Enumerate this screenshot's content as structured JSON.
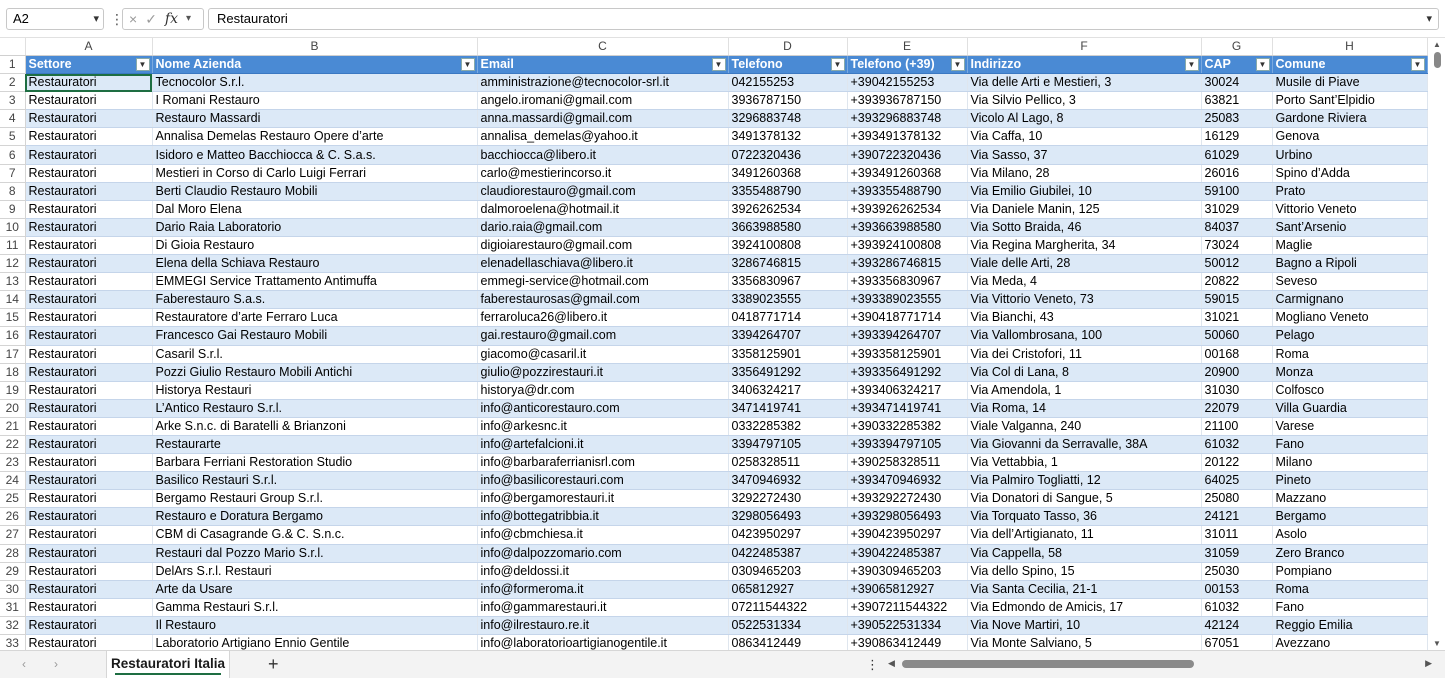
{
  "formula_bar": {
    "name_box": "A2",
    "formula": "Restauratori",
    "separator": "⋮",
    "cancel_icon": "×",
    "enter_icon": "✓",
    "fx_label": "fx"
  },
  "columns": [
    "A",
    "B",
    "C",
    "D",
    "E",
    "F",
    "G",
    "H"
  ],
  "headers": [
    "Settore",
    "Nome Azienda",
    "Email",
    "Telefono",
    "Telefono (+39)",
    "Indirizzo",
    "CAP",
    "Comune"
  ],
  "rows": [
    [
      "Restauratori",
      "Tecnocolor S.r.l.",
      "amministrazione@tecnocolor-srl.it",
      "042155253",
      "+39042155253",
      "Via delle Arti e Mestieri, 3",
      "30024",
      "Musile di Piave"
    ],
    [
      "Restauratori",
      "I Romani Restauro",
      "angelo.iromani@gmail.com",
      "3936787150",
      "+393936787150",
      "Via Silvio Pellico, 3",
      "63821",
      "Porto Sant’Elpidio"
    ],
    [
      "Restauratori",
      "Restauro Massardi",
      "anna.massardi@gmail.com",
      "3296883748",
      "+393296883748",
      "Vicolo Al Lago, 8",
      "25083",
      "Gardone Riviera"
    ],
    [
      "Restauratori",
      "Annalisa Demelas Restauro Opere d’arte",
      "annalisa_demelas@yahoo.it",
      "3491378132",
      "+393491378132",
      "Via Caffa, 10",
      "16129",
      "Genova"
    ],
    [
      "Restauratori",
      "Isidoro e Matteo Bacchiocca & C. S.a.s.",
      "bacchiocca@libero.it",
      "0722320436",
      "+390722320436",
      "Via Sasso, 37",
      "61029",
      "Urbino"
    ],
    [
      "Restauratori",
      "Mestieri in Corso di Carlo Luigi Ferrari",
      "carlo@mestierincorso.it",
      "3491260368",
      "+393491260368",
      "Via Milano, 28",
      "26016",
      "Spino d’Adda"
    ],
    [
      "Restauratori",
      "Berti Claudio Restauro Mobili",
      "claudiorestauro@gmail.com",
      "3355488790",
      "+393355488790",
      "Via Emilio Giubilei, 10",
      "59100",
      "Prato"
    ],
    [
      "Restauratori",
      "Dal Moro Elena",
      "dalmoroelena@hotmail.it",
      "3926262534",
      "+393926262534",
      "Via Daniele Manin, 125",
      "31029",
      "Vittorio Veneto"
    ],
    [
      "Restauratori",
      "Dario Raia Laboratorio",
      "dario.raia@gmail.com",
      "3663988580",
      "+393663988580",
      "Via Sotto Braida, 46",
      "84037",
      "Sant’Arsenio"
    ],
    [
      "Restauratori",
      "Di Gioia Restauro",
      "digioiarestauro@gmail.com",
      "3924100808",
      "+393924100808",
      "Via Regina Margherita, 34",
      "73024",
      "Maglie"
    ],
    [
      "Restauratori",
      "Elena della Schiava Restauro",
      "elenadellaschiava@libero.it",
      "3286746815",
      "+393286746815",
      "Viale delle Arti, 28",
      "50012",
      "Bagno a Ripoli"
    ],
    [
      "Restauratori",
      "EMMEGI Service Trattamento Antimuffa",
      "emmegi-service@hotmail.com",
      "3356830967",
      "+393356830967",
      "Via Meda, 4",
      "20822",
      "Seveso"
    ],
    [
      "Restauratori",
      "Faberestauro S.a.s.",
      "faberestaurosas@gmail.com",
      "3389023555",
      "+393389023555",
      "Via Vittorio Veneto, 73",
      "59015",
      "Carmignano"
    ],
    [
      "Restauratori",
      "Restauratore d’arte Ferraro Luca",
      "ferraroluca26@libero.it",
      "0418771714",
      "+390418771714",
      "Via Bianchi, 43",
      "31021",
      "Mogliano Veneto"
    ],
    [
      "Restauratori",
      "Francesco Gai Restauro Mobili",
      "gai.restauro@gmail.com",
      "3394264707",
      "+393394264707",
      "Via Vallombrosana, 100",
      "50060",
      "Pelago"
    ],
    [
      "Restauratori",
      "Casaril S.r.l.",
      "giacomo@casaril.it",
      "3358125901",
      "+393358125901",
      "Via dei Cristofori, 11",
      "00168",
      "Roma"
    ],
    [
      "Restauratori",
      "Pozzi Giulio Restauro Mobili Antichi",
      "giulio@pozzirestauri.it",
      "3356491292",
      "+393356491292",
      "Via Col di Lana, 8",
      "20900",
      "Monza"
    ],
    [
      "Restauratori",
      "Historya Restauri",
      "historya@dr.com",
      "3406324217",
      "+393406324217",
      "Via Amendola, 1",
      "31030",
      "Colfosco"
    ],
    [
      "Restauratori",
      "L’Antico Restauro S.r.l.",
      "info@anticorestauro.com",
      "3471419741",
      "+393471419741",
      "Via Roma, 14",
      "22079",
      "Villa Guardia"
    ],
    [
      "Restauratori",
      "Arke S.n.c. di Baratelli & Brianzoni",
      "info@arkesnc.it",
      "0332285382",
      "+390332285382",
      "Viale Valganna, 240",
      "21100",
      "Varese"
    ],
    [
      "Restauratori",
      "Restaurarte",
      "info@artefalcioni.it",
      "3394797105",
      "+393394797105",
      "Via Giovanni da Serravalle, 38A",
      "61032",
      "Fano"
    ],
    [
      "Restauratori",
      "Barbara Ferriani Restoration Studio",
      "info@barbaraferrianisrl.com",
      "0258328511",
      "+390258328511",
      "Via Vettabbia, 1",
      "20122",
      "Milano"
    ],
    [
      "Restauratori",
      "Basilico Restauri S.r.l.",
      "info@basilicorestauri.com",
      "3470946932",
      "+393470946932",
      "Via Palmiro Togliatti, 12",
      "64025",
      "Pineto"
    ],
    [
      "Restauratori",
      "Bergamo Restauri Group S.r.l.",
      "info@bergamorestauri.it",
      "3292272430",
      "+393292272430",
      "Via Donatori di Sangue, 5",
      "25080",
      "Mazzano"
    ],
    [
      "Restauratori",
      "Restauro e Doratura Bergamo",
      "info@bottegatribbia.it",
      "3298056493",
      "+393298056493",
      "Via Torquato Tasso, 36",
      "24121",
      "Bergamo"
    ],
    [
      "Restauratori",
      "CBM di Casagrande G.& C. S.n.c.",
      "info@cbmchiesa.it",
      "0423950297",
      "+390423950297",
      "Via dell’Artigianato, 11",
      "31011",
      "Asolo"
    ],
    [
      "Restauratori",
      "Restauri dal Pozzo Mario S.r.l.",
      "info@dalpozzomario.com",
      "0422485387",
      "+390422485387",
      "Via Cappella, 58",
      "31059",
      "Zero Branco"
    ],
    [
      "Restauratori",
      "DelArs S.r.l. Restauri",
      "info@deldossi.it",
      "0309465203",
      "+390309465203",
      "Via dello Spino, 15",
      "25030",
      "Pompiano"
    ],
    [
      "Restauratori",
      "Arte da Usare",
      "info@formeroma.it",
      "065812927",
      "+39065812927",
      "Via Santa Cecilia, 21-1",
      "00153",
      "Roma"
    ],
    [
      "Restauratori",
      "Gamma Restauri S.r.l.",
      "info@gammarestauri.it",
      "07211544322",
      "+3907211544322",
      "Via Edmondo de Amicis, 17",
      "61032",
      "Fano"
    ],
    [
      "Restauratori",
      "Il Restauro",
      "info@ilrestauro.re.it",
      "0522531334",
      "+390522531334",
      "Via Nove Martiri, 10",
      "42124",
      "Reggio Emilia"
    ],
    [
      "Restauratori",
      "Laboratorio Artigiano Ennio Gentile",
      "info@laboratorioartigianogentile.it",
      "0863412449",
      "+390863412449",
      "Via Monte Salviano, 5",
      "67051",
      "Avezzano"
    ]
  ],
  "sheet_tabs": {
    "active": "Restauratori Italia",
    "add_label": "+",
    "more_label": "⋮",
    "prev_label": "‹",
    "next_label": "›"
  }
}
